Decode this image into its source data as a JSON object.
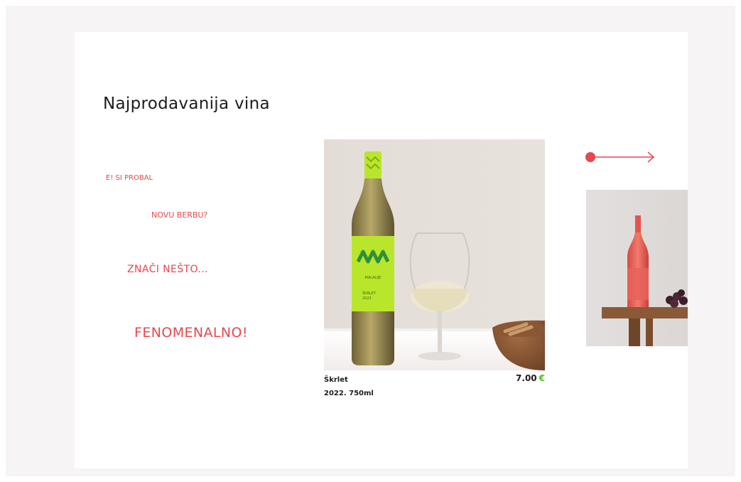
{
  "section": {
    "title": "Najprodavanija vina"
  },
  "taglines": [
    "E! SI PROBAL",
    "NOVU BERBU?",
    "ZNAČI NEŠTO...",
    "FENOMENALNO!"
  ],
  "products": [
    {
      "name": "Škrlet",
      "vintage_volume": "2022. 750ml",
      "price": "7.00",
      "currency": "€",
      "label_text": "MALALIJE",
      "label_variety": "ŠKRLET",
      "label_year": "2022"
    }
  ],
  "icons": {
    "next": "arrow-right-icon"
  },
  "colors": {
    "accent": "#e5484d",
    "currency": "#5fb82c",
    "label_green": "#b9e62b",
    "background": "#f6f4f4"
  }
}
